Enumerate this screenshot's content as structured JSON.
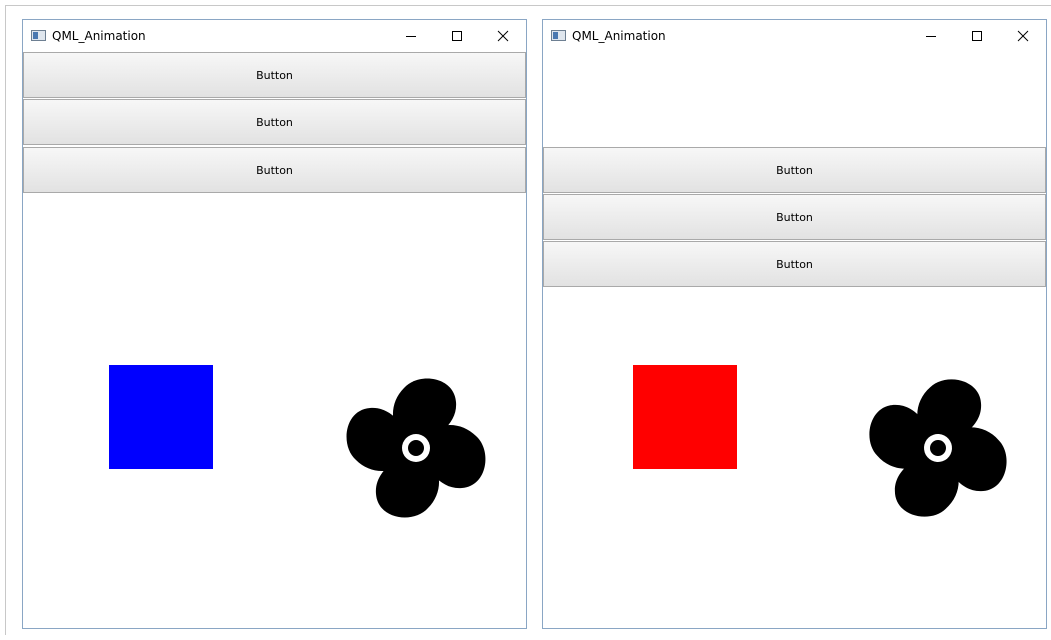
{
  "windows": [
    {
      "title": "QML_Animation",
      "buttons": [
        "Button",
        "Button",
        "Button"
      ],
      "square_color": "#0000ff",
      "square_color_name": "blue"
    },
    {
      "title": "QML_Animation",
      "buttons": [
        "Button",
        "Button",
        "Button"
      ],
      "square_color": "#ff0000",
      "square_color_name": "red"
    }
  ],
  "icons": {
    "app": "qt-window-icon",
    "minimize": "minimize-icon",
    "maximize": "maximize-icon",
    "close": "close-icon",
    "fan": "propeller-fan-icon"
  }
}
